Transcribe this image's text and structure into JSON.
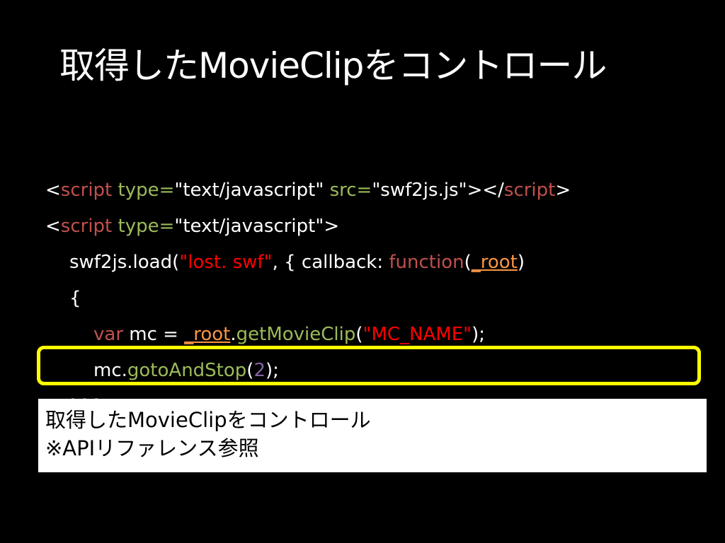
{
  "slide": {
    "title": "取得したMovieClipをコントロール"
  },
  "code": {
    "line1": {
      "lt": "<",
      "tag": "script",
      "sp1": " ",
      "attr1": "type=",
      "val1": "\"text/javascript\"",
      "sp2": " ",
      "attr2": "src=",
      "val2": "\"swf2js.js\"",
      "close": "></",
      "tag2": "script",
      "gt": ">"
    },
    "line2": {
      "lt": "<",
      "tag": "script",
      "sp1": " ",
      "attr1": "type=",
      "val1": "\"text/javascript\"",
      "gt": ">"
    },
    "line3": {
      "pre": "swf2js.load(",
      "str": "\"lost. swf\"",
      "mid": ", { callback: ",
      "kw": "function",
      "paren_open": "(",
      "arg": "_root",
      "paren_close": ")"
    },
    "line4": {
      "brace": "{"
    },
    "line5": {
      "kw": "var",
      "mid": " mc = ",
      "root": "_root",
      "dot": ".",
      "method": "getMovieClip",
      "paren_open": "(",
      "str": "\"MC_NAME\"",
      "end": ");"
    },
    "line6": {
      "obj": "mc.",
      "method": "gotoAndStop",
      "paren_open": "(",
      "num": "2",
      "end": ");"
    },
    "line7": {
      "partial": "}}}"
    }
  },
  "callout": {
    "line1": "取得したMovieClipをコントロール",
    "line2": "※APIリファレンス参照"
  },
  "colors": {
    "background": "#000000",
    "tag": "#c0504d",
    "attribute": "#9bbb59",
    "string": "#ff0000",
    "argument": "#f79646",
    "number": "#8064a2",
    "highlight_border": "#ffff00"
  }
}
